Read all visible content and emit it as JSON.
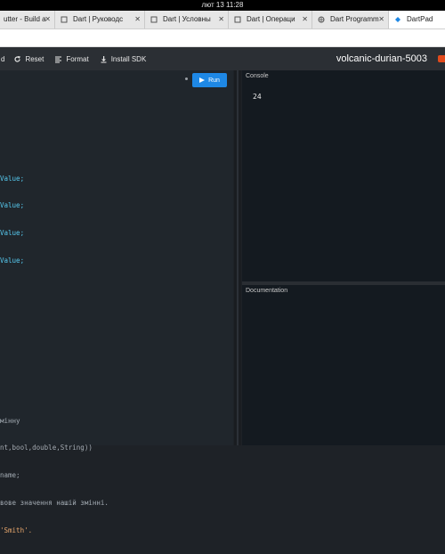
{
  "system": {
    "clock": "лют 13  11:28"
  },
  "tabs": [
    {
      "label": "utter - Build a",
      "icon": "page-icon"
    },
    {
      "label": "Dart | Руководс",
      "icon": "page-icon"
    },
    {
      "label": "Dart | Условны",
      "icon": "page-icon"
    },
    {
      "label": "Dart | Операци",
      "icon": "page-icon"
    },
    {
      "label": "Dart Programm",
      "icon": "globe-icon"
    },
    {
      "label": "DartPad",
      "icon": "dart-icon",
      "active": true
    }
  ],
  "toolbar": {
    "partial_left": "d",
    "reset_label": "Reset",
    "format_label": "Format",
    "install_label": "Install SDK",
    "project_name": "volcanic-durian-5003"
  },
  "editor": {
    "run_label": "Run",
    "code_lines_top": [
      "Value;",
      "Value;",
      "Value;",
      "Value;"
    ],
    "code_lines_bottom": [
      "мінну",
      "nt,bool,double,String))",
      "name;",
      "вове значення нашій змінні.",
      "'Smith'."
    ]
  },
  "console": {
    "label": "Console",
    "output": "24"
  },
  "documentation": {
    "label": "Documentation"
  },
  "colors": {
    "accent": "#1e88e5",
    "toolbar": "#2b2f34",
    "console_bg": "#141a20"
  }
}
